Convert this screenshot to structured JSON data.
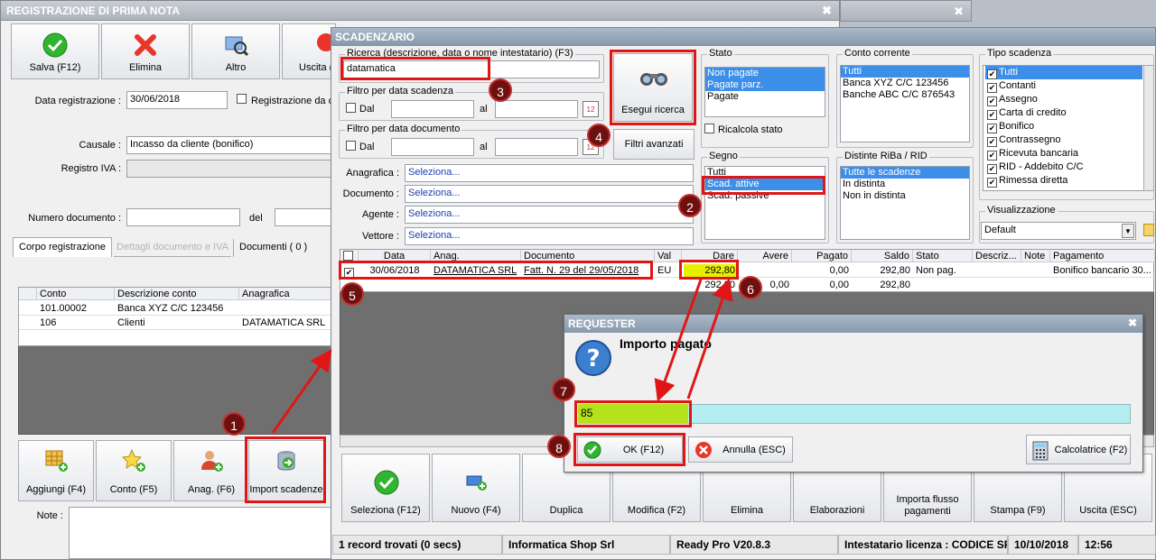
{
  "prima_nota": {
    "title": "REGISTRAZIONE DI PRIMA NOTA",
    "toolbar": {
      "save": "Salva (F12)",
      "delete": "Elimina",
      "other": "Altro",
      "exit": "Uscita ("
    },
    "data_registrazione_label": "Data registrazione :",
    "data_registrazione": "30/06/2018",
    "registrazione_check_label": "Registrazione da c",
    "causale_label": "Causale :",
    "causale": "Incasso da cliente (bonifico)",
    "registro_iva_label": "Registro IVA :",
    "numero_documento_label": "Numero documento :",
    "del_label": "del",
    "tabs": [
      "Corpo registrazione",
      "Dettagli documento e IVA",
      "Documenti ( 0 )"
    ],
    "grid_headers": [
      "Conto",
      "Descrizione conto",
      "Anagrafica"
    ],
    "rows": [
      {
        "conto": "101.00002",
        "descrizione": "Banca XYZ C/C 123456",
        "anagrafica": ""
      },
      {
        "conto": "106",
        "descrizione": "Clienti",
        "anagrafica": "DATAMATICA SRL"
      }
    ],
    "bottom_buttons": {
      "add": "Aggiungi (F4)",
      "conto": "Conto (F5)",
      "anag": "Anag. (F6)",
      "import": "Import scadenze"
    },
    "note_label": "Note :"
  },
  "scadenzario": {
    "title": "SCADENZARIO",
    "search_label": "Ricerca (descrizione, data o nome intestatario) (F3)",
    "search_value": "datamatica",
    "filtro_scadenza_label": "Filtro per data scadenza",
    "filtro_documento_label": "Filtro per data documento",
    "dal_label": "Dal",
    "al_label": "al",
    "esegui_ricerca": "Esegui ricerca",
    "filtri_avanzati": "Filtri avanzati",
    "anagrafica_label": "Anagrafica :",
    "documento_label": "Documento :",
    "agente_label": "Agente :",
    "vettore_label": "Vettore :",
    "seleziona": "Seleziona...",
    "stato_label": "Stato",
    "stato_items": [
      "Non pagate",
      "Pagate parz.",
      "Pagate"
    ],
    "ricalcola_stato": "Ricalcola stato",
    "segno_label": "Segno",
    "segno_items": [
      "Tutti",
      "Scad. attive",
      "Scad. passive"
    ],
    "conto_label": "Conto corrente",
    "conto_items": [
      "Tutti",
      "Banca XYZ C/C 123456",
      "Banche ABC C/C 876543"
    ],
    "distinte_label": "Distinte RiBa / RID",
    "distinte_items": [
      "Tutte le scadenze",
      "In distinta",
      "Non in distinta"
    ],
    "tipo_label": "Tipo scadenza",
    "tipo_items": [
      "Tutti",
      "Contanti",
      "Assegno",
      "Carta di credito",
      "Bonifico",
      "Contrassegno",
      "Ricevuta bancaria",
      "RID - Addebito C/C",
      "Rimessa diretta"
    ],
    "visualizzazione_label": "Visualizzazione",
    "visualizzazione_value": "Default",
    "grid_headers": [
      "Data",
      "Anag.",
      "Documento",
      "Val",
      "Dare",
      "Avere",
      "Pagato",
      "Saldo",
      "Stato",
      "Descriz...",
      "Note",
      "Pagamento"
    ],
    "row": {
      "data": "30/06/2018",
      "anag": "DATAMATICA SRL",
      "documento": "Fatt. N. 29 del 29/05/2018",
      "val": "EU",
      "dare": "292,80",
      "avere": "",
      "pagato": "0,00",
      "saldo": "292,80",
      "stato": "Non pag.",
      "pagamento": "Bonifico bancario 30..."
    },
    "totals": {
      "dare": "292,80",
      "avere": "0,00",
      "pagato": "0,00",
      "saldo": "292,80"
    },
    "bottom_buttons": {
      "seleziona": "Seleziona (F12)",
      "nuovo": "Nuovo (F4)",
      "duplica": "Duplica",
      "modifica": "Modifica (F2)",
      "elimina": "Elimina",
      "elaborazioni": "Elaborazioni",
      "importa": "Importa flusso pagamenti",
      "stampa": "Stampa (F9)",
      "uscita": "Uscita (ESC)"
    },
    "status": {
      "records": "1 record trovati (0 secs)",
      "company": "Informatica Shop Srl",
      "version": "Ready Pro V20.8.3",
      "license": "Intestatario licenza : CODICE SR",
      "date": "10/10/2018",
      "time": "12:56"
    }
  },
  "requester": {
    "title": "REQUESTER",
    "question": "Importo pagato",
    "value": "85",
    "ok": "OK (F12)",
    "annulla": "Annulla (ESC)",
    "calcolatrice": "Calcolatrice (F2)"
  },
  "badges": [
    "1",
    "2",
    "3",
    "4",
    "5",
    "6",
    "7",
    "8"
  ],
  "colors": {
    "accent_red": "#e01616",
    "selection": "#3c8ee8",
    "highlight_yellow": "#e6f000",
    "input_green": "#b5e21a",
    "input_cyan": "#b4eef0"
  }
}
